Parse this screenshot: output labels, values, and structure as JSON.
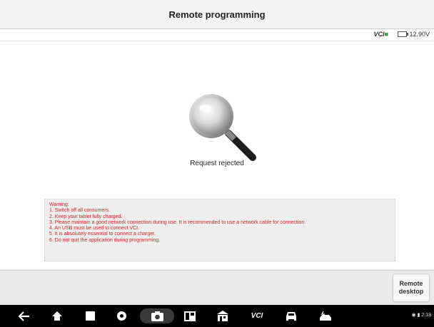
{
  "header": {
    "title": "Remote programming"
  },
  "status": {
    "vci_label": "VCI",
    "voltage": "12.90V"
  },
  "main": {
    "status_message": "Request rejected"
  },
  "warning": {
    "lines": [
      "Warning:",
      "1. Switch off all consumers.",
      "2. Keep your tablet fully charged.",
      "3. Please maintain a good network connection during use. It is recommended to use a network cable for connection.",
      "4. An USB must be used to connect VCI.",
      "5. It is absolutely essential to connect a charger.",
      "6. Do not quit the application during programming."
    ]
  },
  "bottombar": {
    "remote_desktop_label": "Remote desktop"
  },
  "navbar": {
    "items": [
      "back-icon",
      "home-icon",
      "recent-apps-icon",
      "browser-icon",
      "screenshot-icon",
      "multi-window-icon",
      "shop-icon",
      "vci-icon",
      "car-icon",
      "ev-car-icon"
    ],
    "vci_text": "VCI",
    "system_status": "2:18"
  },
  "colors": {
    "warning": "#d22222",
    "vci_ok": "#2e9d3a"
  }
}
